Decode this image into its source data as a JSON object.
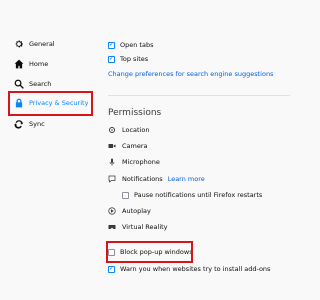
{
  "sidebar": {
    "items": [
      {
        "label": "General",
        "icon": "gear-icon"
      },
      {
        "label": "Home",
        "icon": "home-icon"
      },
      {
        "label": "Search",
        "icon": "search-icon"
      },
      {
        "label": "Privacy & Security",
        "icon": "lock-icon",
        "selected": true
      },
      {
        "label": "Sync",
        "icon": "sync-icon"
      }
    ]
  },
  "search_suggestions": {
    "open_tabs": {
      "label": "Open tabs",
      "checked": true
    },
    "top_sites": {
      "label": "Top sites",
      "checked": true
    },
    "change_link": "Change preferences for search engine suggestions"
  },
  "permissions": {
    "title": "Permissions",
    "items": [
      {
        "label": "Location",
        "icon": "location-icon"
      },
      {
        "label": "Camera",
        "icon": "camera-icon"
      },
      {
        "label": "Microphone",
        "icon": "microphone-icon"
      },
      {
        "label": "Notifications",
        "icon": "notification-icon",
        "link": "Learn more"
      },
      {
        "label": "Autoplay",
        "icon": "autoplay-icon"
      },
      {
        "label": "Virtual Reality",
        "icon": "vr-icon"
      }
    ],
    "pause_notifications": {
      "label": "Pause notifications until Firefox restarts",
      "checked": false
    },
    "block_popups": {
      "label": "Block pop-up windows",
      "checked": false
    },
    "warn_addons": {
      "label": "Warn you when websites try to install add-ons",
      "checked": true
    }
  },
  "colors": {
    "accent": "#0a84ff",
    "highlight": "#d7141a"
  }
}
